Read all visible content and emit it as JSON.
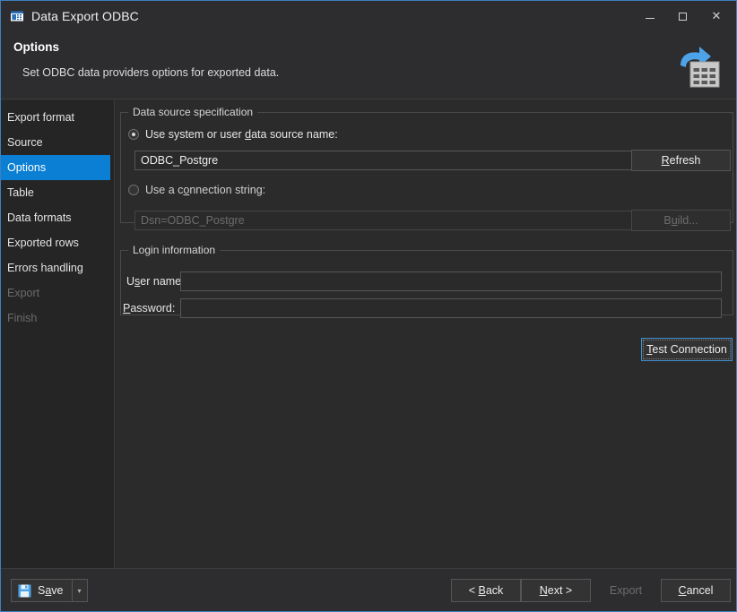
{
  "window": {
    "title": "Data Export ODBC",
    "icon": "app-grid-icon",
    "minimize_label": "Minimize",
    "maximize_label": "Maximize",
    "close_label": "Close"
  },
  "header": {
    "title": "Options",
    "subtitle": "Set ODBC data providers options for exported data.",
    "icon": "export-table-icon"
  },
  "sidebar": {
    "items": [
      {
        "label": "Export format",
        "state": "normal"
      },
      {
        "label": "Source",
        "state": "normal"
      },
      {
        "label": "Options",
        "state": "selected"
      },
      {
        "label": "Table",
        "state": "normal"
      },
      {
        "label": "Data formats",
        "state": "normal"
      },
      {
        "label": "Exported rows",
        "state": "normal"
      },
      {
        "label": "Errors handling",
        "state": "normal"
      },
      {
        "label": "Export",
        "state": "disabled"
      },
      {
        "label": "Finish",
        "state": "disabled"
      }
    ]
  },
  "data_source": {
    "group_title": "Data source specification",
    "radio_dsn": {
      "label_before": "Use system or user ",
      "accel": "d",
      "label_after": "ata source name:",
      "checked": true
    },
    "dsn_combo": {
      "value": "ODBC_Postgre",
      "arrow": "▾",
      "enabled": true
    },
    "refresh_button": {
      "label_before": "",
      "accel": "R",
      "label_after": "efresh",
      "enabled": true
    },
    "radio_connstr": {
      "label_before": "Use a c",
      "accel": "o",
      "label_after": "nnection string:",
      "checked": false
    },
    "connstr_field": {
      "value": "Dsn=ODBC_Postgre",
      "enabled": false
    },
    "build_button": {
      "label_before": "B",
      "accel": "u",
      "label_after": "ild...",
      "enabled": false
    }
  },
  "login": {
    "group_title": "Login information",
    "username": {
      "label_before": "U",
      "accel": "s",
      "label_after": "er name:",
      "value": ""
    },
    "password": {
      "label_before": "",
      "accel": "P",
      "label_after": "assword:",
      "value": ""
    }
  },
  "test_connection_button": {
    "label_before": "",
    "accel": "T",
    "label_after": "est Connection",
    "focused": true
  },
  "footer": {
    "save_button": {
      "label_before": "S",
      "accel": "a",
      "label_after": "ve",
      "icon": "floppy-save-icon"
    },
    "save_dropdown_arrow": "▾",
    "back_button": {
      "label_before": "< ",
      "accel": "B",
      "label_after": "ack",
      "enabled": true
    },
    "next_button": {
      "label_before": "",
      "accel": "N",
      "label_after": "ext >",
      "enabled": true
    },
    "export_button": {
      "label_before": "Export",
      "accel": "",
      "label_after": "",
      "enabled": false
    },
    "cancel_button": {
      "label_before": "",
      "accel": "C",
      "label_after": "ancel",
      "enabled": true
    }
  },
  "colors": {
    "accent": "#0a7fd4",
    "window_border": "#3f7fbf",
    "panel_bg": "#2b2b2b",
    "chrome_bg": "#2d2d30",
    "sidebar_bg": "#252526",
    "text": "#e6e6e6",
    "text_disabled": "#6d6d6d"
  }
}
